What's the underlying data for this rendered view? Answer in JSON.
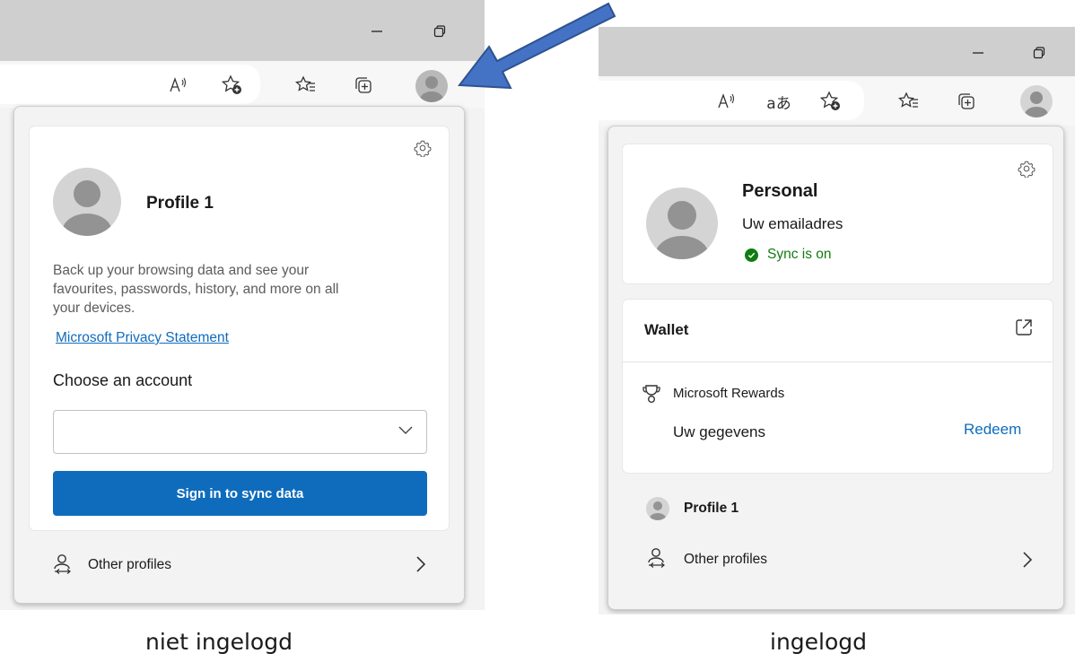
{
  "left": {
    "profile_name": "Profile 1",
    "description": [
      "Back up your browsing data and see your",
      "favourites, passwords, history, and more on all",
      "your devices."
    ],
    "privacy_link": "Microsoft Privacy Statement",
    "choose_label": "Choose an account",
    "account_select_value": "",
    "sign_in_button": "Sign in to sync data",
    "other_profiles": "Other profiles",
    "caption": "niet ingelogd"
  },
  "right": {
    "profile_name": "Personal",
    "email": "Uw emailadres",
    "sync_status": "Sync is on",
    "wallet_title": "Wallet",
    "rewards_label": "Microsoft Rewards",
    "rewards_value": "Uw gegevens",
    "redeem": "Redeem",
    "profile_row": "Profile 1",
    "other_profiles": "Other profiles",
    "translate_icon_text": "aあ",
    "caption": "ingelogd"
  },
  "colors": {
    "accent": "#0f6cbd",
    "sync_green": "#107c10",
    "annotation_arrow": "#4472c4"
  },
  "icons": [
    "minimize-icon",
    "restore-icon",
    "read-aloud-icon",
    "translate-icon",
    "add-favorite-icon",
    "favorites-icon",
    "collections-icon",
    "profile-avatar-icon",
    "settings-gear-icon",
    "chevron-down-icon",
    "chevron-right-icon",
    "switch-profiles-icon",
    "checkmark-icon",
    "open-external-icon",
    "rewards-trophy-icon",
    "pointer-arrow"
  ]
}
